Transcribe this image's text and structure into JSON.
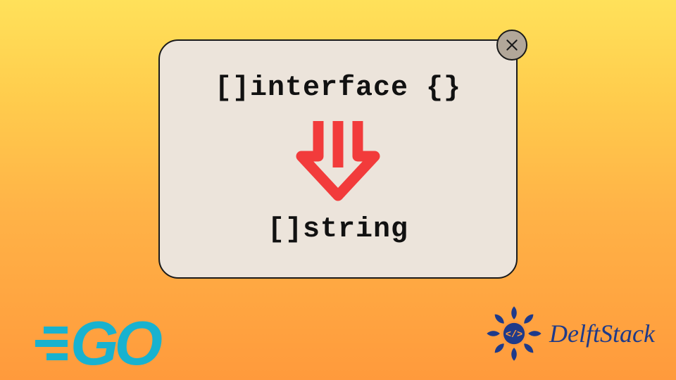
{
  "card": {
    "top_code": "[]interface {}",
    "bottom_code": "[]string"
  },
  "icons": {
    "close": "close-icon",
    "arrow": "down-arrow-icon",
    "go_stripes": "go-speed-lines",
    "delft_badge": "delftstack-badge-icon"
  },
  "logos": {
    "go_text": "GO",
    "delft_text": "DelftStack"
  },
  "colors": {
    "accent_arrow": "#f23b3b",
    "go_brand": "#18b2cf",
    "delft_brand": "#1e3a8a",
    "card_bg": "#ece4db",
    "close_bg": "#b2a799"
  }
}
